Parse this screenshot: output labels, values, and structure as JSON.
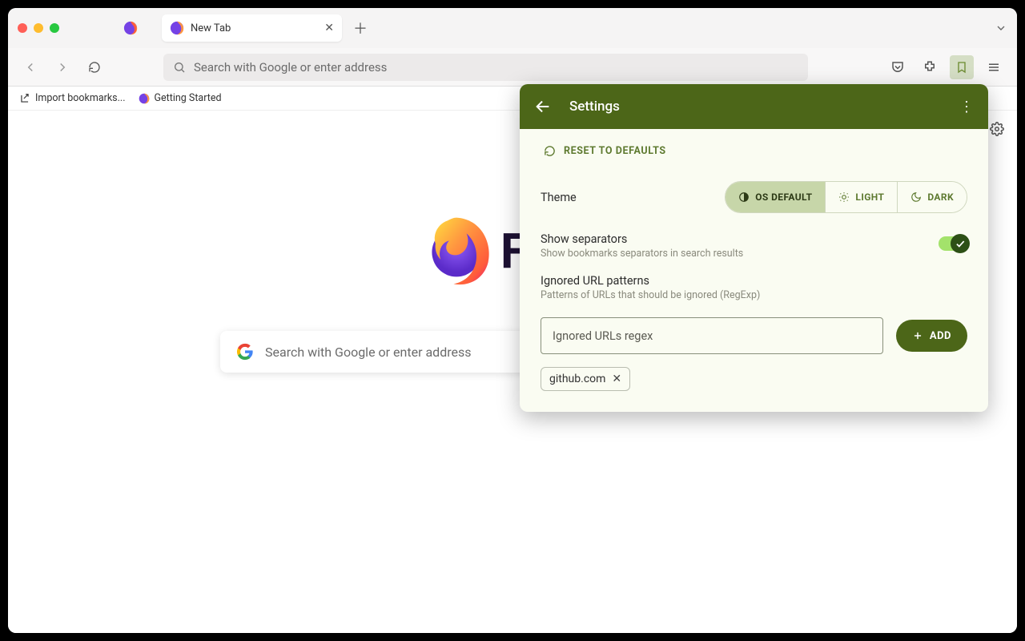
{
  "tab": {
    "title": "New Tab"
  },
  "addressbar": {
    "placeholder": "Search with Google or enter address"
  },
  "bookmarks": {
    "import": "Import bookmarks...",
    "getting_started": "Getting Started"
  },
  "newtab": {
    "logo_letter": "F",
    "search_placeholder": "Search with Google or enter address"
  },
  "panel": {
    "title": "Settings",
    "reset": "RESET TO DEFAULTS",
    "theme": {
      "label": "Theme",
      "os": "OS DEFAULT",
      "light": "LIGHT",
      "dark": "DARK",
      "selected": "os"
    },
    "separators": {
      "title": "Show separators",
      "desc": "Show bookmarks separators in search results",
      "on": true
    },
    "ignored": {
      "title": "Ignored URL patterns",
      "desc": "Patterns of URLs that should be ignored (RegExp)",
      "placeholder": "Ignored URLs regex",
      "add": "ADD",
      "chips": [
        "github.com"
      ]
    }
  }
}
